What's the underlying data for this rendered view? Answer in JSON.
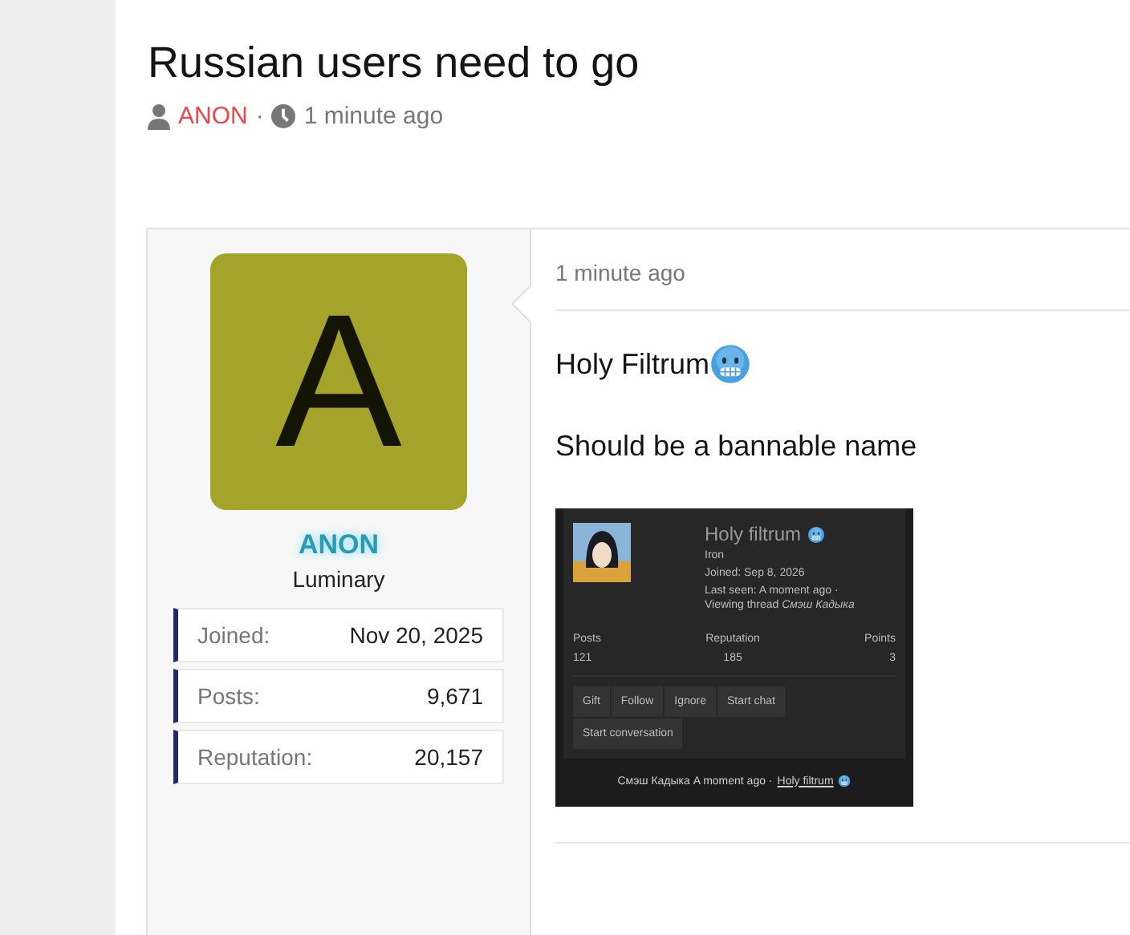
{
  "thread": {
    "title": "Russian users need to go",
    "author": "ANON",
    "separator": "·",
    "time": "1 minute ago"
  },
  "post": {
    "user": {
      "avatar_letter": "A",
      "name": "ANON",
      "rank": "Luminary",
      "stats": [
        {
          "label": "Joined:",
          "value": "Nov 20, 2025"
        },
        {
          "label": "Posts:",
          "value": "9,671"
        },
        {
          "label": "Reputation:",
          "value": "20,157"
        }
      ]
    },
    "time": "1 minute ago",
    "lines": [
      {
        "kind": "text_with_emoji",
        "text": "Holy Filtrum"
      },
      {
        "kind": "text",
        "text": "Should be a bannable name"
      }
    ],
    "attachment": {
      "name": "Holy filtrum",
      "rank": "Iron",
      "joined": "Joined: Sep 8, 2026",
      "last_seen": "Last seen: A moment ago ·",
      "viewing": "Viewing thread *Смэш Кадыка*",
      "stats": [
        {
          "label": "Posts",
          "value": "121"
        },
        {
          "label": "Reputation",
          "value": "185"
        },
        {
          "label": "Points",
          "value": "3"
        }
      ],
      "buttons": [
        "Gift",
        "Follow",
        "Ignore",
        "Start chat",
        "Start conversation"
      ],
      "footer": {
        "text": "Смэш Кадыка A moment ago ·",
        "link": "Holy filtrum"
      }
    }
  }
}
